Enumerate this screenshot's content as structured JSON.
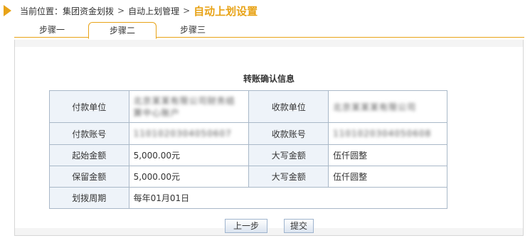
{
  "breadcrumb": {
    "prefix": "当前位置：",
    "items": [
      "集团资金划拨",
      "自动上划管理"
    ],
    "separator": ">",
    "current": "自动上划设置"
  },
  "tabs": [
    {
      "label": "步骤一",
      "active": false
    },
    {
      "label": "步骤二",
      "active": true
    },
    {
      "label": "步骤三",
      "active": false
    }
  ],
  "confirm": {
    "title": "转账确认信息",
    "rows": [
      {
        "l1": "付款单位",
        "v1": "北京某某有限公司财务结算中心账户",
        "l2": "收款单位",
        "v2": "北京某某某有限公司"
      },
      {
        "l1": "付款账号",
        "v1": "1101020304050607",
        "l2": "收款账号",
        "v2": "1101020304050608"
      },
      {
        "l1": "起始金额",
        "v1": "5,000.00元",
        "l2": "大写金额",
        "v2": "伍仟圆整"
      },
      {
        "l1": "保留金额",
        "v1": "5,000.00元",
        "l2": "大写金额",
        "v2": "伍仟圆整"
      },
      {
        "l1": "划拨周期",
        "v1": "每年01月01日"
      }
    ]
  },
  "buttons": {
    "prev": "上一步",
    "submit": "提交"
  },
  "colors": {
    "accent": "#e8a317",
    "label_bg": "#eef3f9",
    "border": "#a9b8c8"
  }
}
